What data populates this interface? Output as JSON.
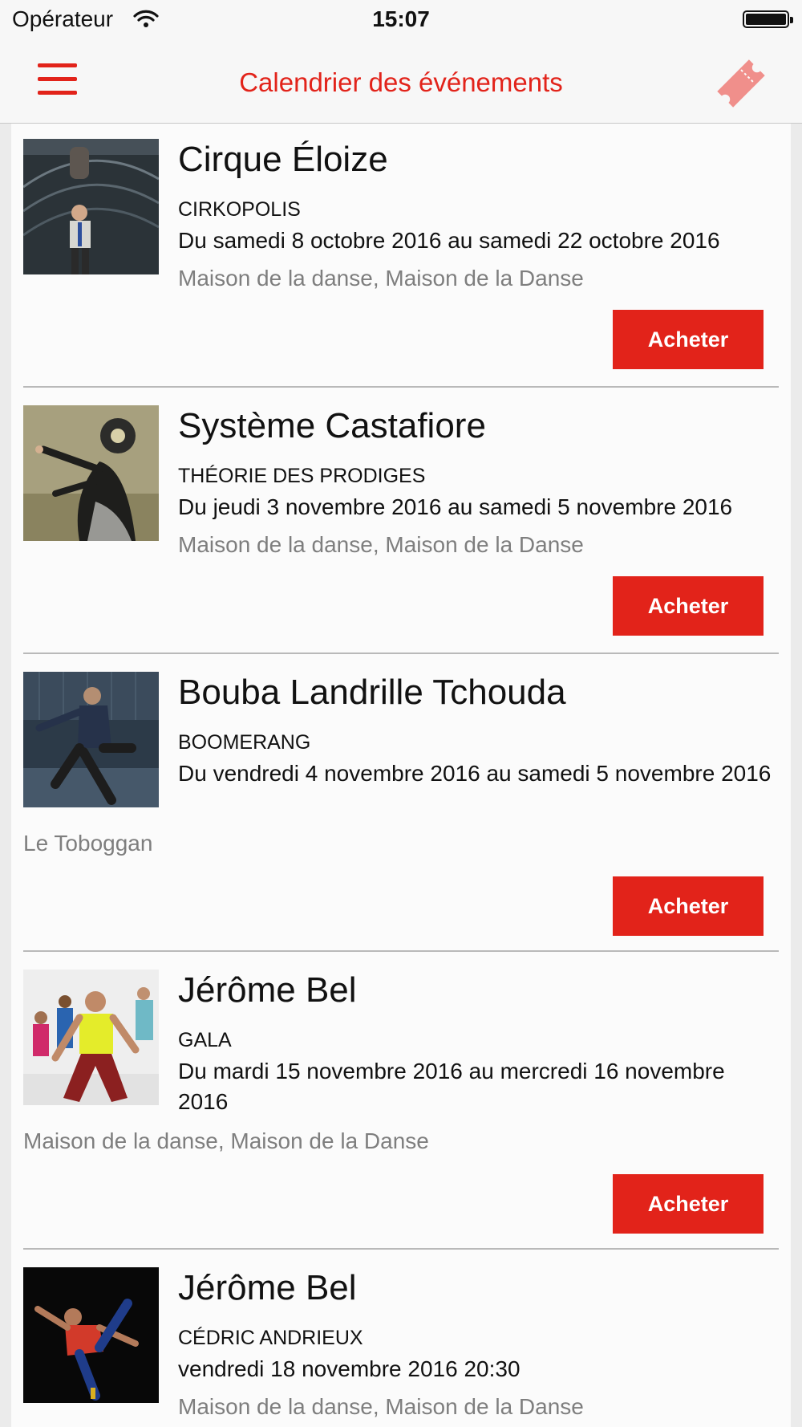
{
  "status_bar": {
    "carrier": "Opérateur",
    "time": "15:07"
  },
  "nav": {
    "title": "Calendrier des événements"
  },
  "colors": {
    "accent": "#e2231a",
    "secondary_text": "#7e7e7e"
  },
  "events": [
    {
      "title": "Cirque Éloize",
      "subtitle": "CIRKOPOLIS",
      "date": "Du samedi 8 octobre 2016 au samedi 22 octobre 2016",
      "venue": "Maison de la danse, Maison de la Danse",
      "buy_label": "Acheter"
    },
    {
      "title": "Système Castafiore",
      "subtitle": "THÉORIE DES PRODIGES",
      "date": "Du jeudi 3 novembre 2016 au samedi 5 novembre 2016",
      "venue": "Maison de la danse, Maison de la Danse",
      "buy_label": "Acheter"
    },
    {
      "title": "Bouba Landrille Tchouda",
      "subtitle": "BOOMERANG",
      "date": "Du vendredi 4 novembre 2016 au samedi 5 novembre 2016",
      "venue": "Le Toboggan",
      "buy_label": "Acheter"
    },
    {
      "title": "Jérôme Bel",
      "subtitle": "GALA",
      "date": "Du mardi 15 novembre 2016 au mercredi 16 novembre 2016",
      "venue": "Maison de la danse, Maison de la Danse",
      "buy_label": "Acheter"
    },
    {
      "title": "Jérôme Bel",
      "subtitle": "CÉDRIC ANDRIEUX",
      "date": "vendredi 18 novembre 2016 20:30",
      "venue": "Maison de la danse, Maison de la Danse"
    }
  ]
}
